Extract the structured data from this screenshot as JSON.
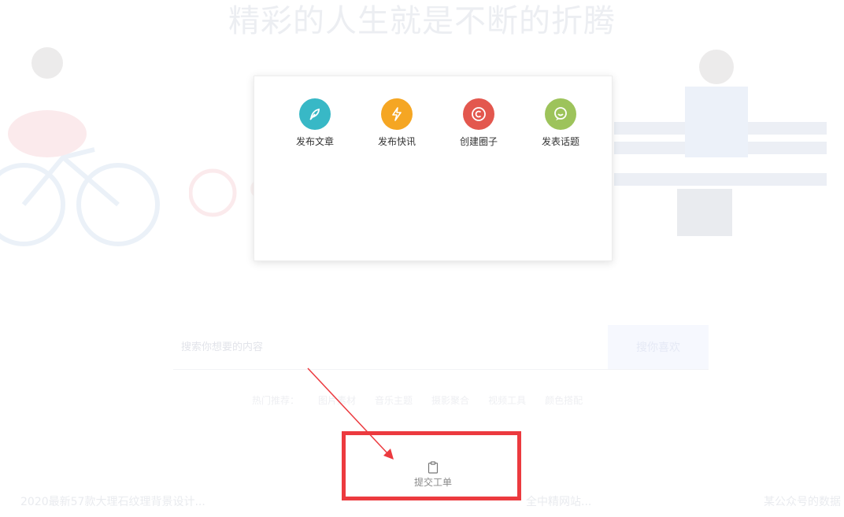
{
  "hero": {
    "title": "精彩的人生就是不断的折腾"
  },
  "search": {
    "placeholder": "搜索你想要的内容",
    "button_label": "搜你喜欢"
  },
  "hot": {
    "label": "热门推荐：",
    "tags": [
      "图片素材",
      "音乐主题",
      "摄影聚合",
      "视频工具",
      "颜色搭配"
    ]
  },
  "popup": {
    "actions": [
      {
        "label": "发布文章",
        "icon": "feather-icon",
        "color": "#38b8c6"
      },
      {
        "label": "发布快讯",
        "icon": "lightning-icon",
        "color": "#f5a623"
      },
      {
        "label": "创建圈子",
        "icon": "circle-c-icon",
        "color": "#e3574e"
      },
      {
        "label": "发表话题",
        "icon": "chat-bubble-icon",
        "color": "#9dc35b"
      }
    ]
  },
  "ticket": {
    "label": "提交工单",
    "icon": "clipboard-icon"
  },
  "bottom": {
    "items": [
      "2020最新57款大理石纹理背景设计...",
      "全中精网站...",
      "某公众号的数据"
    ]
  },
  "annotation": {
    "box_color": "#ec3a3f"
  }
}
